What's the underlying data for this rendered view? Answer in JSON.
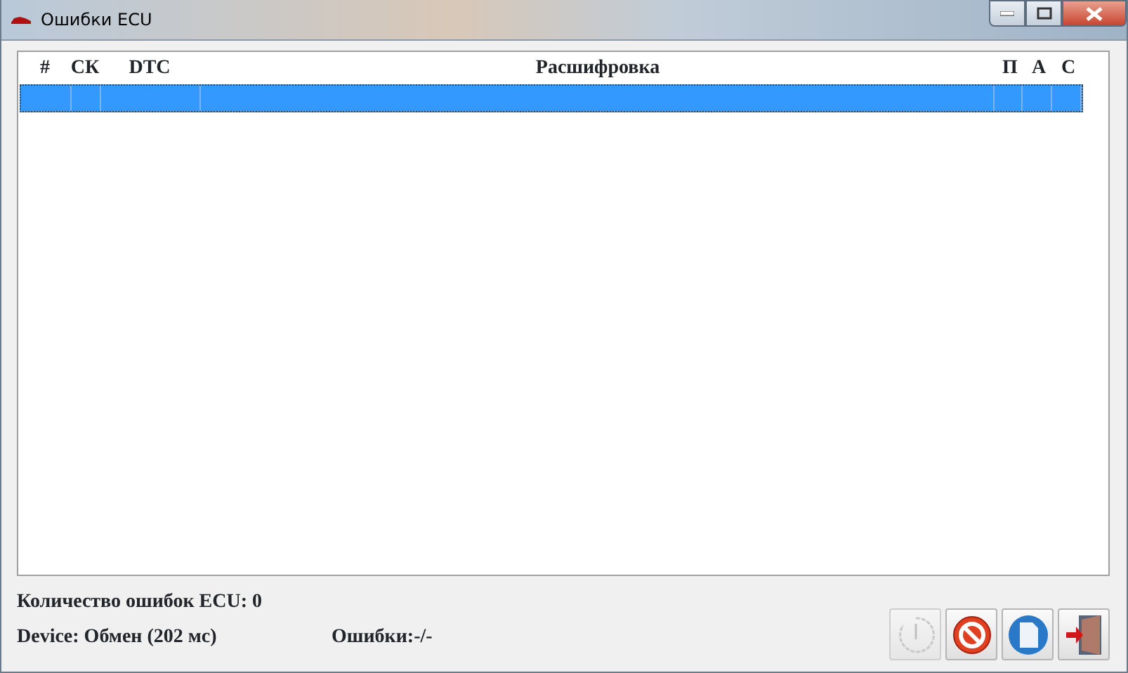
{
  "window": {
    "title": "Ошибки ECU"
  },
  "table": {
    "columns": [
      "#",
      "СК",
      "DTC",
      "Расшифровка",
      "П",
      "А",
      "С"
    ],
    "rows": [
      {
        "selected": true
      }
    ]
  },
  "status": {
    "error_count": "Количество ошибок ECU: 0",
    "device": "Device: Обмен (202 мс)",
    "errors": "Ошибки:-/-"
  },
  "buttons": [
    {
      "kind": "timer",
      "disabled": true
    },
    {
      "kind": "stop",
      "disabled": false
    },
    {
      "kind": "document",
      "disabled": false
    },
    {
      "kind": "exit",
      "disabled": false
    }
  ]
}
